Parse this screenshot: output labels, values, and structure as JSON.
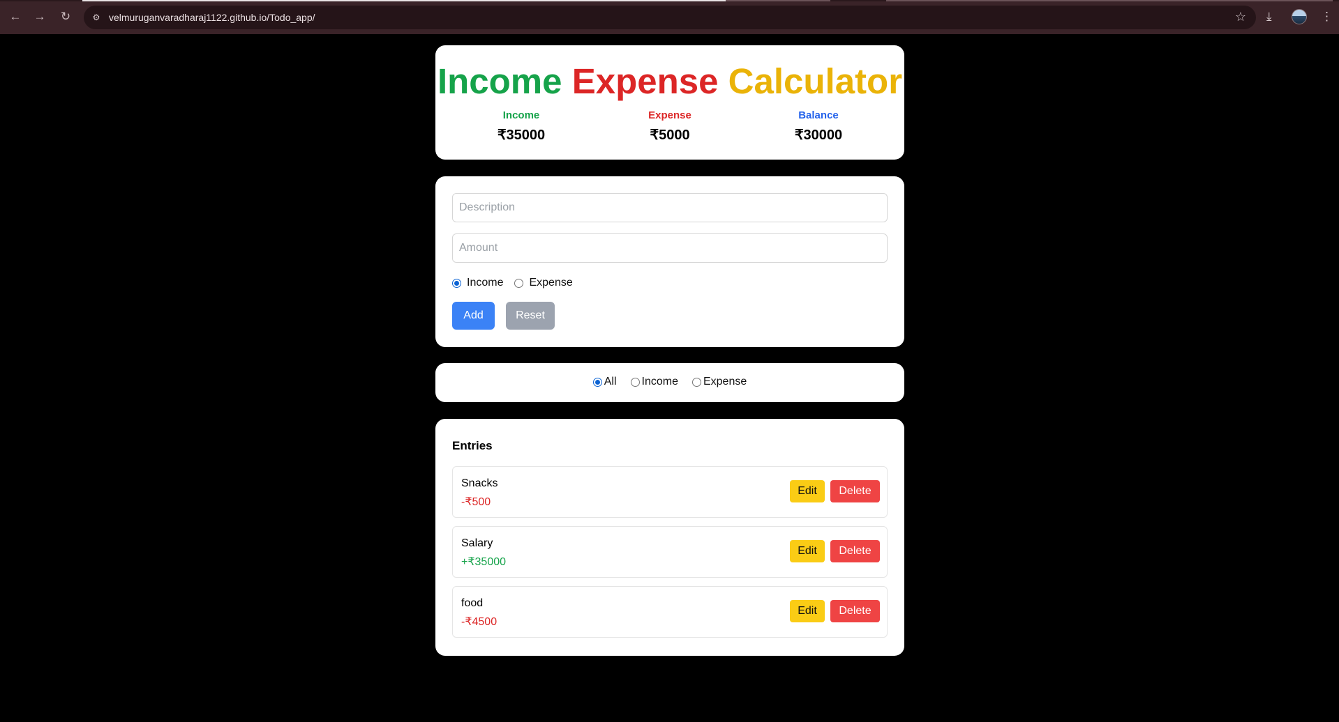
{
  "browser": {
    "url": "velmuruganvaradharaj1122.github.io/Todo_app/",
    "back_icon": "back-arrow-icon",
    "forward_icon": "forward-arrow-icon",
    "reload_icon": "reload-icon",
    "site_info_icon": "tune-icon",
    "star_icon": "star-icon",
    "download_icon": "download-icon",
    "menu_icon": "kebab-menu-icon"
  },
  "header": {
    "title_income": "Income",
    "title_expense": "Expense",
    "title_calculator": "Calculator",
    "summary": {
      "income_label": "Income",
      "income_value": "₹35000",
      "expense_label": "Expense",
      "expense_value": "₹5000",
      "balance_label": "Balance",
      "balance_value": "₹30000"
    }
  },
  "form": {
    "description_placeholder": "Description",
    "description_value": "",
    "amount_placeholder": "Amount",
    "amount_value": "",
    "type_options": [
      "Income",
      "Expense"
    ],
    "type_selected": "Income",
    "add_label": "Add",
    "reset_label": "Reset"
  },
  "filter": {
    "options": [
      "All",
      "Income",
      "Expense"
    ],
    "selected": "All"
  },
  "entries": {
    "heading": "Entries",
    "items": [
      {
        "description": "Snacks",
        "amount": "-₹500",
        "type": "expense"
      },
      {
        "description": "Salary",
        "amount": "+₹35000",
        "type": "income"
      },
      {
        "description": "food",
        "amount": "-₹4500",
        "type": "expense"
      }
    ],
    "edit_label": "Edit",
    "delete_label": "Delete"
  },
  "colors": {
    "income": "#16a34a",
    "expense": "#dc2626",
    "calculator": "#eab308",
    "balance": "#2563eb",
    "add_button": "#3b82f6",
    "reset_button": "#9ca3af",
    "edit_button": "#facc15",
    "delete_button": "#ef4444"
  }
}
